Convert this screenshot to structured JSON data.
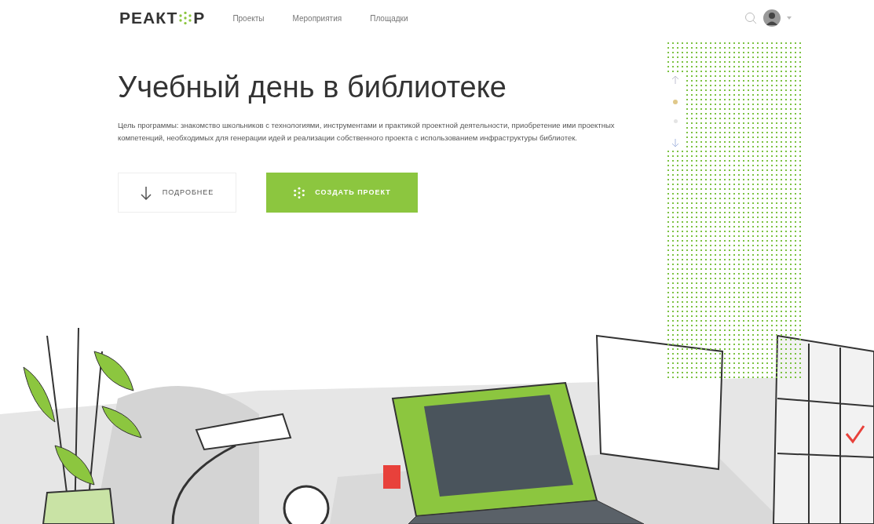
{
  "header": {
    "logo": {
      "before": "РЕАКТ",
      "after": "Р"
    },
    "nav": [
      {
        "label": "Проекты",
        "selected": false
      },
      {
        "label": "Мероприятия",
        "selected": false
      },
      {
        "label": "Площадки",
        "selected": false
      }
    ]
  },
  "hero": {
    "title": "Учебный день в библиотеке",
    "description": "Цель программы: знакомство школьников с технологиями, инструментами и практикой проектной деятельности, приобретение ими проектных компетенций, необходимых для генерации идей и реализации собственного проекта с использованием инфраструктуры библиотек.",
    "buttons": [
      {
        "label": "ПОДРОБНЕЕ",
        "kind": "outline"
      },
      {
        "label": "СОЗДАТЬ ПРОЕКТ",
        "kind": "primary"
      }
    ]
  },
  "pager": [
    {
      "selected": true
    },
    {
      "selected": false
    }
  ]
}
